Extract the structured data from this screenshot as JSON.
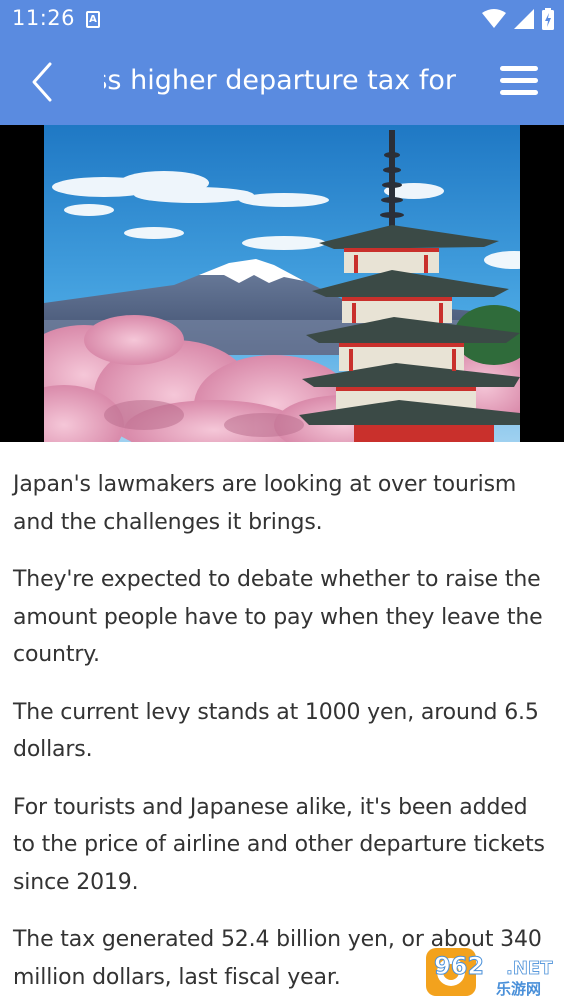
{
  "status_bar": {
    "time": "11:26",
    "notification_badge": "A",
    "icons": [
      "wifi-icon",
      "signal-icon",
      "battery-icon"
    ]
  },
  "header": {
    "title": "Japan's lawmakers discuss higher departure tax for",
    "icons": [
      "back-arrow-icon",
      "hamburger-menu-icon"
    ]
  },
  "article": {
    "paragraphs": [
      "Japan's lawmakers are looking at over tourism and the challenges it brings.",
      "They're expected to debate whether to raise the amount people have to pay when they leave the country.",
      "The current levy stands at 1000 yen, around 6.5 dollars.",
      "For tourists and Japanese alike, it's been added to the price of airline and other departure tickets since 2019.",
      "The tax generated 52.4 billion yen, or about 340 million dollars, last fiscal year."
    ]
  },
  "watermark": {
    "brand": "962.NET",
    "subtitle": "乐游网"
  },
  "colors": {
    "accent": "#5a8be0",
    "text": "#333333"
  }
}
